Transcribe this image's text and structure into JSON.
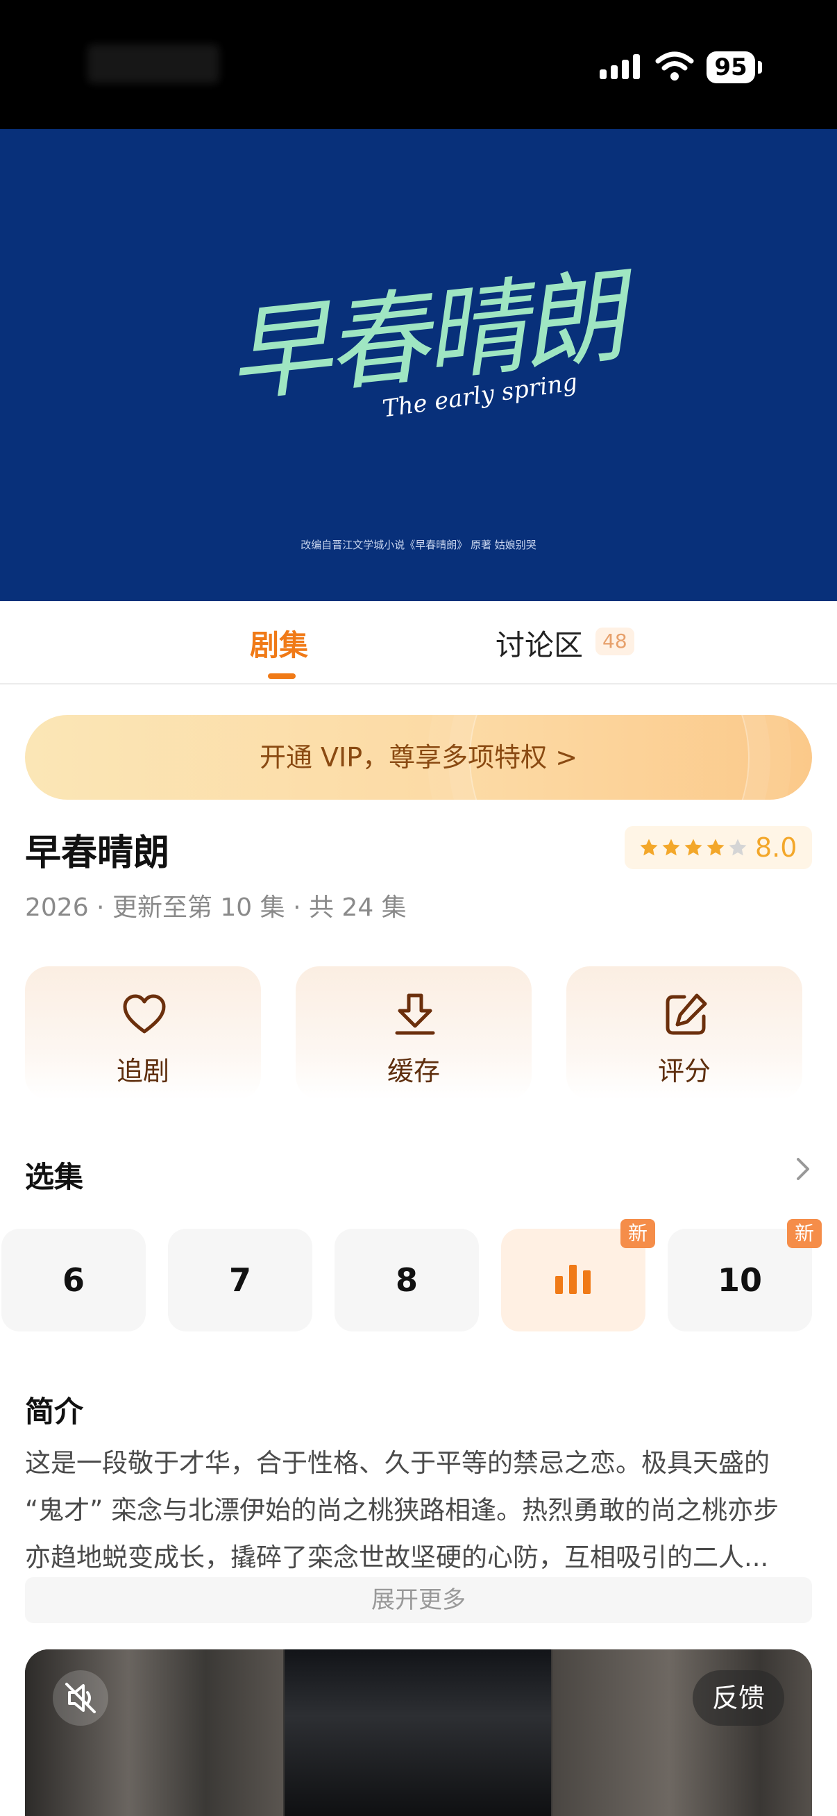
{
  "status_bar": {
    "battery": "95",
    "icons": [
      "signal-icon",
      "wifi-icon",
      "battery-icon"
    ]
  },
  "banner": {
    "title": "早春晴朗",
    "subtitle": "The early spring",
    "credit": "改编自晋江文学城小说《早春晴朗》 原著 姑娘别哭"
  },
  "tabs": [
    {
      "label": "剧集",
      "active": true
    },
    {
      "label": "讨论区",
      "count": "48",
      "active": false
    }
  ],
  "vip_banner": {
    "text": "开通 VIP，尊享多项特权 >"
  },
  "show": {
    "title": "早春晴朗",
    "rating": "8.0",
    "stars_filled": 4,
    "stars_total": 5,
    "meta": "2026 · 更新至第 10 集 · 共 24 集"
  },
  "actions": [
    {
      "label": "追剧",
      "icon": "heart-icon"
    },
    {
      "label": "缓存",
      "icon": "download-icon"
    },
    {
      "label": "评分",
      "icon": "edit-icon"
    }
  ],
  "episodes": {
    "title": "选集",
    "items": [
      {
        "label": "6"
      },
      {
        "label": "7"
      },
      {
        "label": "8"
      },
      {
        "label": "",
        "playing": true,
        "badge": "新"
      },
      {
        "label": "10",
        "badge": "新"
      }
    ]
  },
  "synopsis": {
    "title": "简介",
    "lines": [
      "这是一段敬于才华，合于性格、久于平等的禁忌之恋。极具天盛的",
      "“鬼才” 栾念与北漂伊始的尚之桃狭路相逢。热烈勇敢的尚之桃亦步",
      "亦趋地蜕变成长，撬碎了栾念世故坚硬的心防，互相吸引的二人..."
    ],
    "expand_label": "展开更多"
  },
  "video": {
    "feedback_label": "反馈",
    "icons": [
      "mute-icon"
    ]
  },
  "colors": {
    "accent": "#f07a17",
    "banner_bg": "#08307a",
    "star": "#f3a72a"
  }
}
